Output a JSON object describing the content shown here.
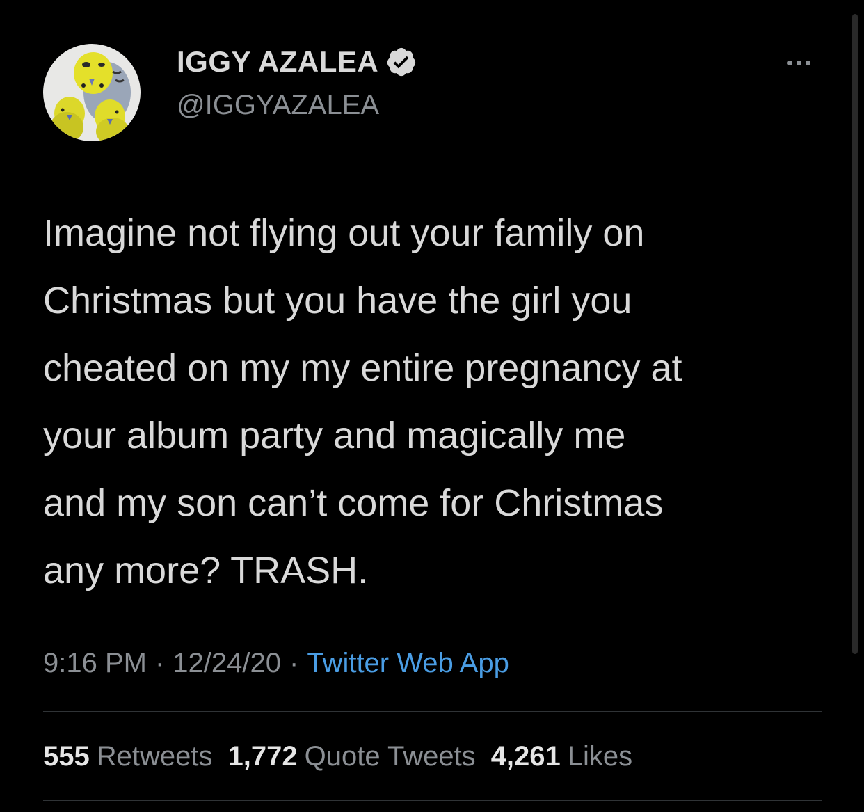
{
  "author": {
    "display_name": "IGGY AZALEA",
    "handle": "@IGGYAZALEA",
    "verified": true
  },
  "tweet": {
    "text": "Imagine not flying out your family on\nChristmas but you have the girl you\ncheated on my my entire pregnancy at\nyour album party and magically me\nand my son can’t come for Christmas\nany more? TRASH."
  },
  "meta": {
    "time": "9:16 PM",
    "separator": "·",
    "date": "12/24/20",
    "source": "Twitter Web App"
  },
  "stats": {
    "retweets_count": "555",
    "retweets_label": "Retweets",
    "quotes_count": "1,772",
    "quotes_label": "Quote Tweets",
    "likes_count": "4,261",
    "likes_label": "Likes"
  },
  "icons": {
    "verified": "verified-badge-icon",
    "more": "more-options-icon",
    "avatar": "budgie-birds-avatar"
  },
  "colors": {
    "background": "#000000",
    "text_primary": "#d9d9d9",
    "text_secondary": "#8b8f94",
    "link": "#4a9de4",
    "divider": "#2f3336"
  }
}
